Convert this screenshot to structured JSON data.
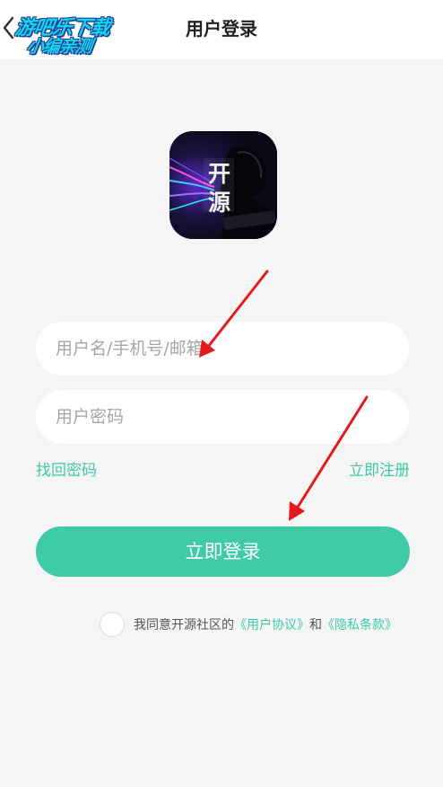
{
  "header": {
    "title": "用户登录",
    "back_icon": "chevron-left-icon"
  },
  "watermark": {
    "line1": "游吧乐下载",
    "line2": "小编亲测"
  },
  "logo": {
    "text_top": "开",
    "text_bottom": "源"
  },
  "form": {
    "username_placeholder": "用户名/手机号/邮箱",
    "password_placeholder": "用户密码",
    "forgot_label": "找回密码",
    "register_label": "立即注册",
    "login_label": "立即登录"
  },
  "agreement": {
    "prefix": "我同意开源社区的",
    "user_agreement": "《用户协议》",
    "conjunction": "和",
    "privacy_terms": "《隐私条款》"
  },
  "colors": {
    "accent": "#3ecba6",
    "annotation_arrow": "#e3191c",
    "watermark": "#14d4ef"
  }
}
